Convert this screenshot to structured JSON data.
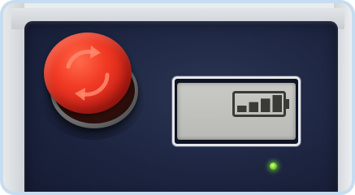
{
  "device": {
    "panel_color": "#1c2440",
    "frame_color": "#c7dcef"
  },
  "emergency_stop": {
    "icon": "rotate-arrows-icon",
    "color": "#f23b25"
  },
  "battery_display": {
    "icon": "battery-level-icon",
    "bars_filled": 4,
    "bars_total": 4,
    "level_fraction": 1.0,
    "screen_color": "#c2c3bf"
  },
  "status_led": {
    "state": "on",
    "color": "#7fe02a"
  }
}
